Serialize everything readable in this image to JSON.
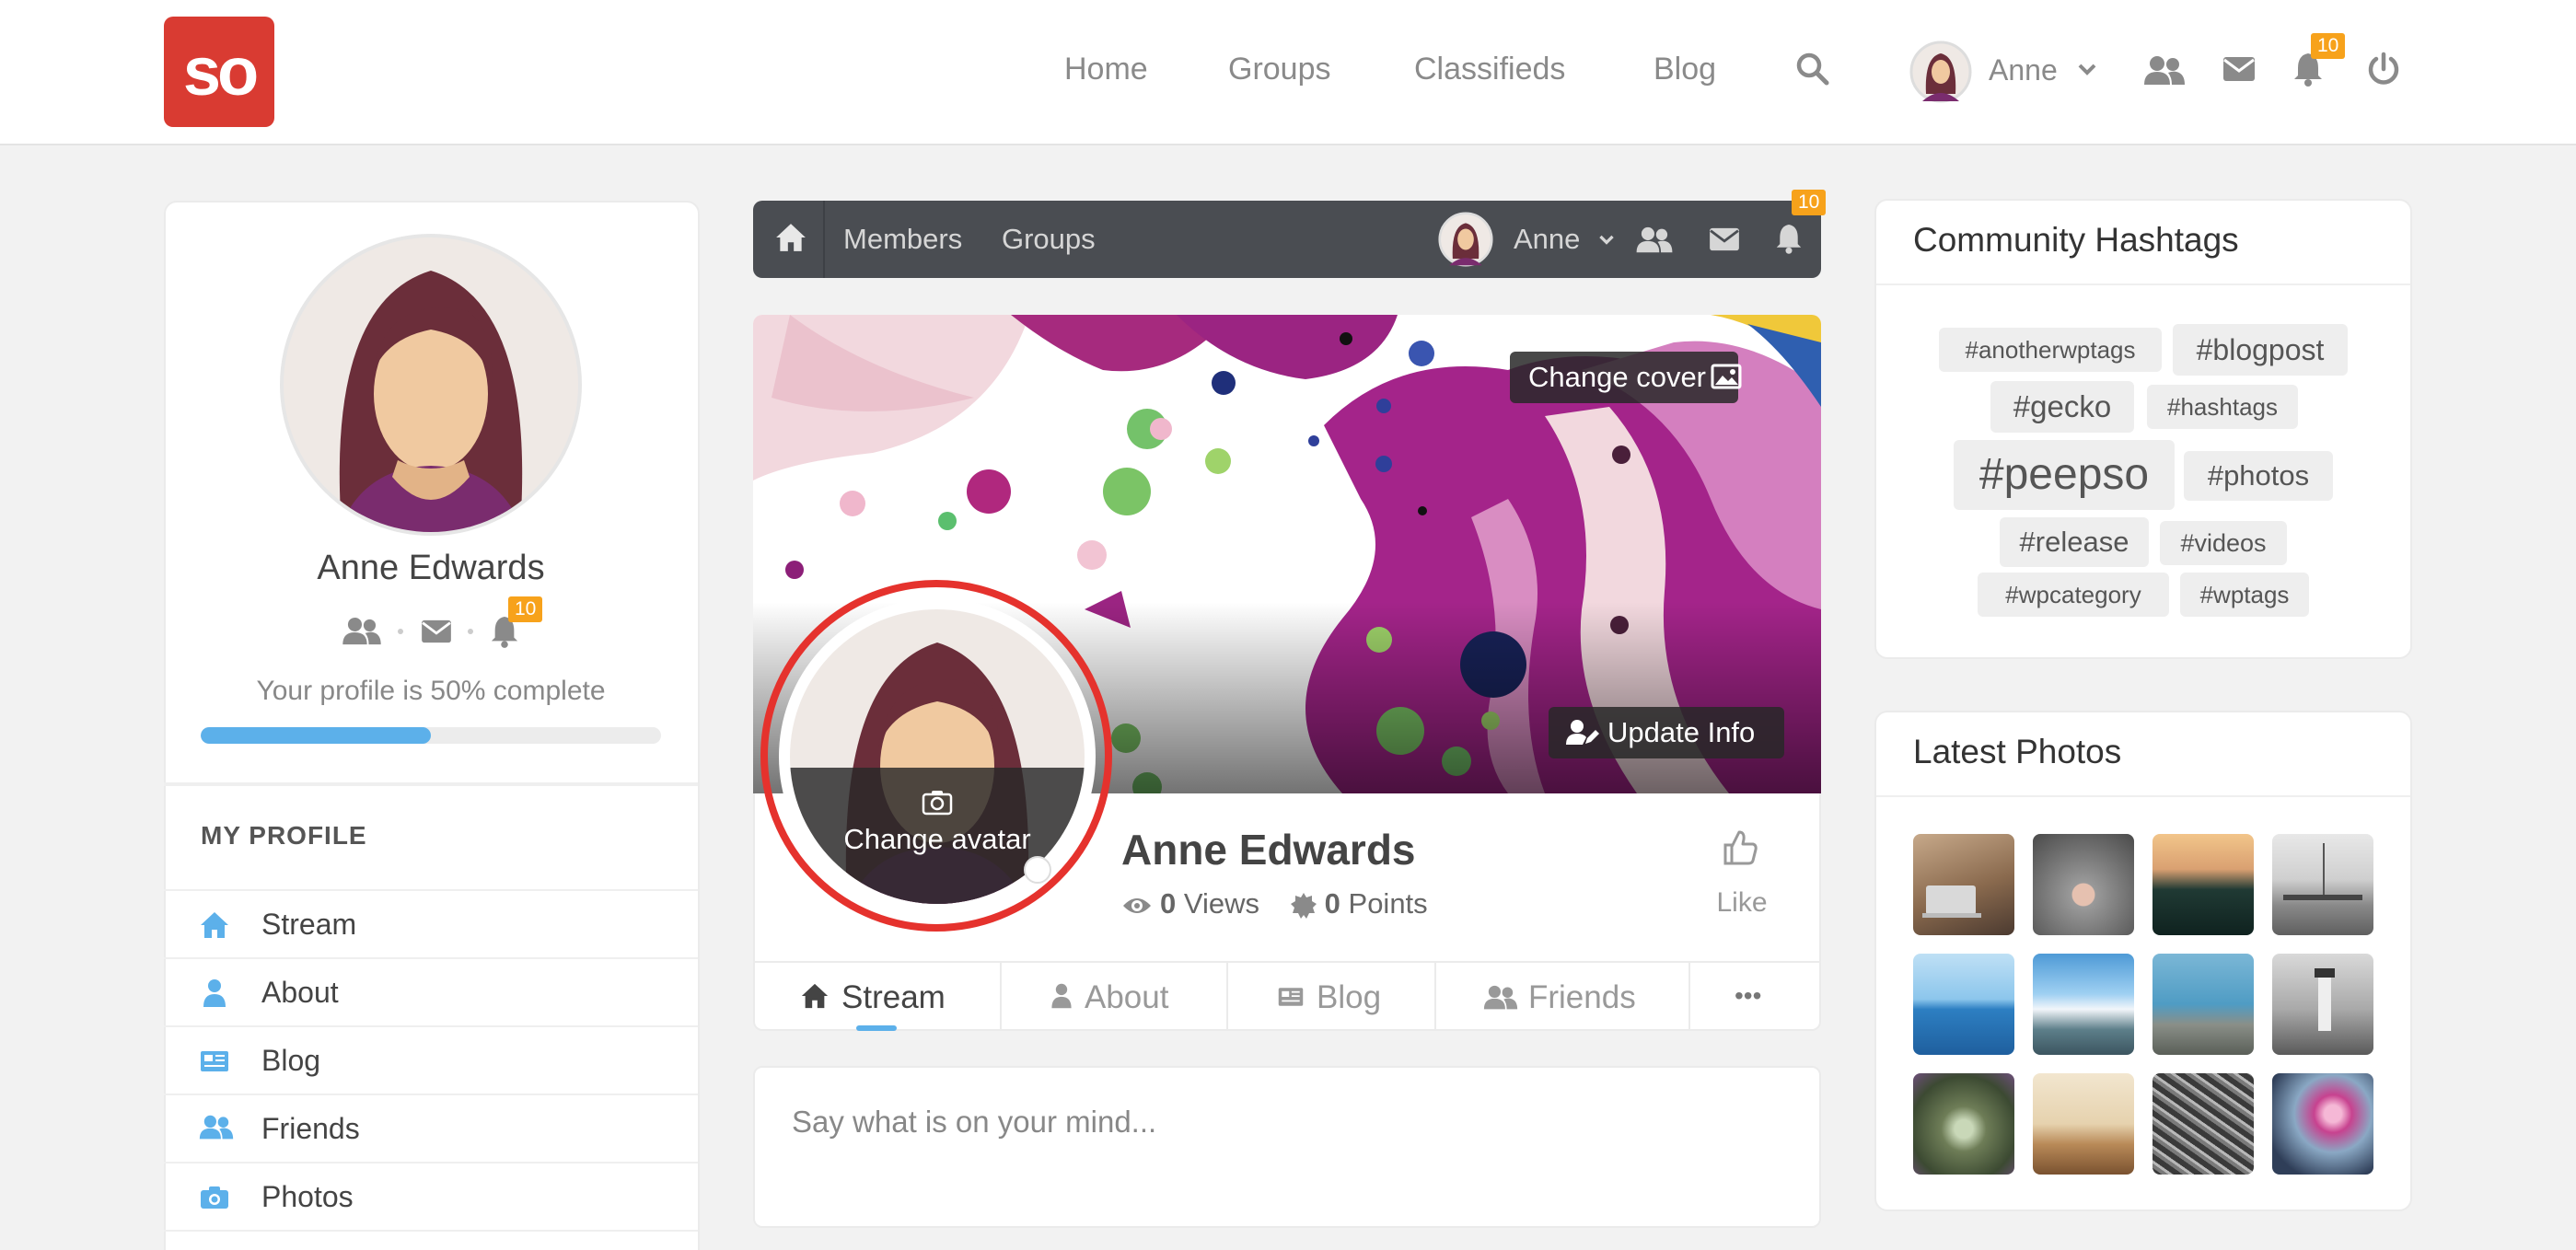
{
  "brand": {
    "logo_text": "so",
    "accent": "#d93b32"
  },
  "topnav": {
    "links": [
      "Home",
      "Groups",
      "Classifieds",
      "Blog"
    ],
    "user_name": "Anne",
    "notification_count": "10"
  },
  "left_profile": {
    "name": "Anne Edwards",
    "notification_count": "10",
    "completion_text": "Your profile is 50% complete",
    "completion_fraction": 0.5,
    "section_title": "MY PROFILE",
    "menu": [
      "Stream",
      "About",
      "Blog",
      "Friends",
      "Photos"
    ]
  },
  "profile_bar": {
    "links": [
      "Members",
      "Groups"
    ],
    "user_name": "Anne",
    "notification_count": "10"
  },
  "cover": {
    "change_cover_label": "Change cover",
    "update_info_label": "Update Info",
    "change_avatar_label": "Change avatar"
  },
  "profile": {
    "name": "Anne Edwards",
    "views_count": "0",
    "views_label": "Views",
    "points_count": "0",
    "points_label": "Points",
    "like_label": "Like"
  },
  "tabs": [
    "Stream",
    "About",
    "Blog",
    "Friends",
    "•••"
  ],
  "composer": {
    "placeholder": "Say what is on your mind..."
  },
  "hashtags": {
    "title": "Community Hashtags",
    "tags": [
      "#anotherwptags",
      "#blogpost",
      "#gecko",
      "#hashtags",
      "#peepso",
      "#photos",
      "#release",
      "#videos",
      "#wpcategory",
      "#wptags"
    ]
  },
  "latest_photos": {
    "title": "Latest Photos"
  }
}
